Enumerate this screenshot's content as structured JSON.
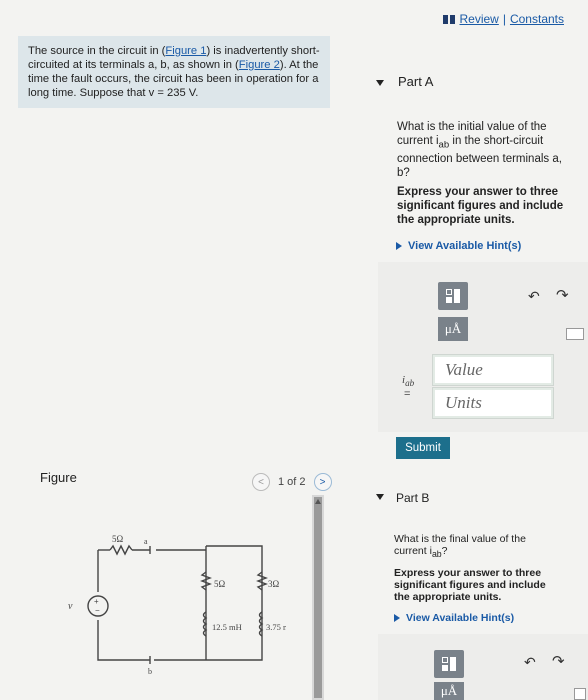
{
  "header": {
    "review": "Review",
    "separator": "|",
    "constants": "Constants"
  },
  "problem": {
    "t1": "The source in the circuit in (",
    "fig1": "Figure 1",
    "t2": ") is inadvertently short-circuited at its terminals a, b, as shown in (",
    "fig2": "Figure 2",
    "t3": "). At the time the fault occurs, the circuit has been in operation for a long time. Suppose that v = 235 V."
  },
  "partA": {
    "title": "Part A",
    "question": "What is the initial value of the current i",
    "question_sub": "ab",
    "question_rest": " in the short-circuit connection between terminals a, b?",
    "instruction": "Express your answer to three significant figures and include the appropriate units.",
    "hint": "View Available Hint(s)",
    "var_label": "i",
    "var_sub": "ab",
    "equals": "=",
    "value_placeholder": "Value",
    "units_placeholder": "Units",
    "mu_label": "μÅ",
    "submit": "Submit"
  },
  "figure": {
    "label": "Figure",
    "pager": "1 of 2",
    "prev": "<",
    "next": ">",
    "circuit": {
      "r_series": "5Ω",
      "node_a": "a",
      "node_b": "b",
      "r1": "5Ω",
      "r2": "3Ω",
      "l1": "12.5 mH",
      "l2": "3.75 mH",
      "source": "v",
      "plus": "+",
      "minus": "−"
    }
  },
  "partB": {
    "title": "Part B",
    "question": "What is the final value of the current i",
    "question_sub": "ab",
    "question_rest": "?",
    "instruction": "Express your answer to three significant figures and include the appropriate units.",
    "hint": "View Available Hint(s)",
    "mu_label": "μÅ"
  }
}
